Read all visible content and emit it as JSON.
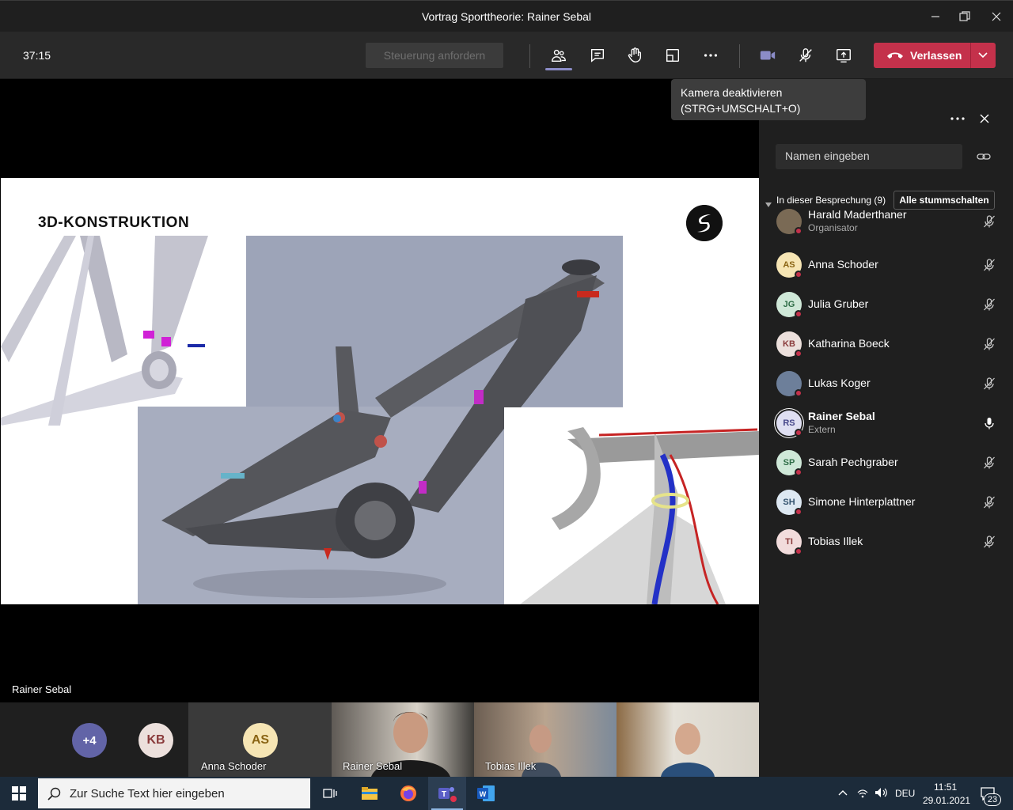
{
  "window": {
    "title": "Vortrag Sporttheorie: Rainer Sebal"
  },
  "toolbar": {
    "timer": "37:15",
    "request_control": "Steuerung anfordern",
    "leave": "Verlassen"
  },
  "tooltip": {
    "line1": "Kamera deaktivieren",
    "line2": "(STRG+UMSCHALT+O)"
  },
  "stage": {
    "slide_title": "3D-KONSTRUKTION",
    "presenter": "Rainer Sebal"
  },
  "strip": {
    "overflow": "+4",
    "kb_initials": "KB",
    "as_initials": "AS",
    "anna": "Anna Schoder",
    "rainer": "Rainer Sebal",
    "tobias": "Tobias Illek"
  },
  "panel": {
    "search_placeholder": "Namen eingeben",
    "section_label": "In dieser Besprechung (9)",
    "mute_all": "Alle stummschalten",
    "participants": [
      {
        "initials": "",
        "name": "Harald Maderthaner",
        "role": "Organisator",
        "mic": "muted"
      },
      {
        "initials": "AS",
        "name": "Anna Schoder",
        "role": "",
        "mic": "muted"
      },
      {
        "initials": "JG",
        "name": "Julia Gruber",
        "role": "",
        "mic": "muted"
      },
      {
        "initials": "KB",
        "name": "Katharina Boeck",
        "role": "",
        "mic": "muted"
      },
      {
        "initials": "",
        "name": "Lukas Koger",
        "role": "",
        "mic": "muted"
      },
      {
        "initials": "RS",
        "name": "Rainer Sebal",
        "role": "Extern",
        "mic": "on"
      },
      {
        "initials": "SP",
        "name": "Sarah Pechgraber",
        "role": "",
        "mic": "muted"
      },
      {
        "initials": "SH",
        "name": "Simone Hinterplattner",
        "role": "",
        "mic": "muted"
      },
      {
        "initials": "TI",
        "name": "Tobias Illek",
        "role": "",
        "mic": "muted"
      }
    ]
  },
  "taskbar": {
    "search": "Zur Suche Text hier eingeben",
    "lang": "DEU",
    "time": "11:51",
    "date": "29.01.2021",
    "notifications": "23"
  },
  "colors": {
    "leave_red": "#c4314b",
    "accent_purple": "#6264a7",
    "panel_bg": "#1f1f1f",
    "toolbar_bg": "#292929"
  }
}
